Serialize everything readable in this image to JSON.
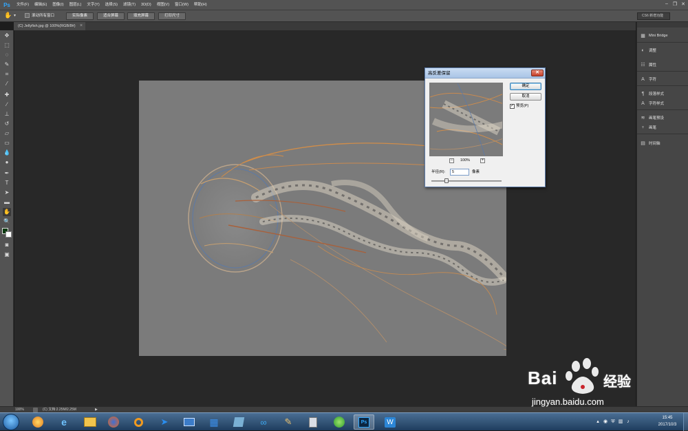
{
  "app": {
    "logo": "Ps",
    "menus": [
      "文件(F)",
      "编辑(E)",
      "图像(I)",
      "图层(L)",
      "文字(Y)",
      "选择(S)",
      "滤镜(T)",
      "3D(D)",
      "视图(V)",
      "窗口(W)",
      "帮助(H)"
    ],
    "window_controls": [
      "–",
      "❐",
      "✕"
    ]
  },
  "options_bar": {
    "scroll_all_label": "滚动所有窗口",
    "buttons": [
      "实际像素",
      "适合屏幕",
      "填充屏幕",
      "打印尺寸"
    ],
    "workspace": "CS6 新增功能"
  },
  "document": {
    "tab_title": "(C) Jellyfish.jpg @ 100%(RGB/8#)",
    "close_glyph": "×"
  },
  "right_panel": {
    "items": [
      {
        "icon": "mini-bridge-icon",
        "label": "Mini Bridge"
      },
      {
        "icon": "adjustments-icon",
        "label": "调整"
      },
      {
        "icon": "properties-icon",
        "label": "属性"
      },
      {
        "icon": "character-icon",
        "label": "字符"
      },
      {
        "icon": "paragraph-styles-icon",
        "label": "段落样式"
      },
      {
        "icon": "character-styles-icon",
        "label": "字符样式"
      },
      {
        "icon": "brush-presets-icon",
        "label": "画笔预设"
      },
      {
        "icon": "brush-icon",
        "label": "画笔"
      },
      {
        "icon": "timeline-icon",
        "label": "时间轴"
      }
    ]
  },
  "dialog": {
    "title": "高反差保留",
    "ok_label": "确定",
    "cancel_label": "取消",
    "preview_label": "预览(P)",
    "preview_checked": true,
    "zoom": "100%",
    "radius_label": "半径(R):",
    "radius_value": "5",
    "radius_unit": "像素",
    "radius_slider_level": 0.22
  },
  "status_bar": {
    "zoom": "100%",
    "doc_info": "(C) 文档:2.25M/2.25M",
    "arrow": "▶"
  },
  "taskbar": {
    "apps": [
      "qq-icon",
      "ie-icon",
      "explorer-icon",
      "firefox-icon",
      "search-app-icon",
      "feiq-icon",
      "remote-desktop-icon",
      "tiles-icon",
      "notes-icon",
      "baidu-netdisk-icon",
      "paint-icon",
      "calculator-icon",
      "browser-icon",
      "photoshop-icon",
      "wps-icon"
    ],
    "active_app_label": "Ps",
    "clock_time": "15:45",
    "clock_date": "2017/10/3"
  },
  "watermark": {
    "brand": "Bai",
    "brand_cn": "经验",
    "url": "jingyan.baidu.com"
  },
  "colors": {
    "ps_blue": "#31a8ff",
    "foreground_swatch": "#0b3a10",
    "background_swatch": "#ffffff",
    "watermark_red": "#c9252c"
  }
}
